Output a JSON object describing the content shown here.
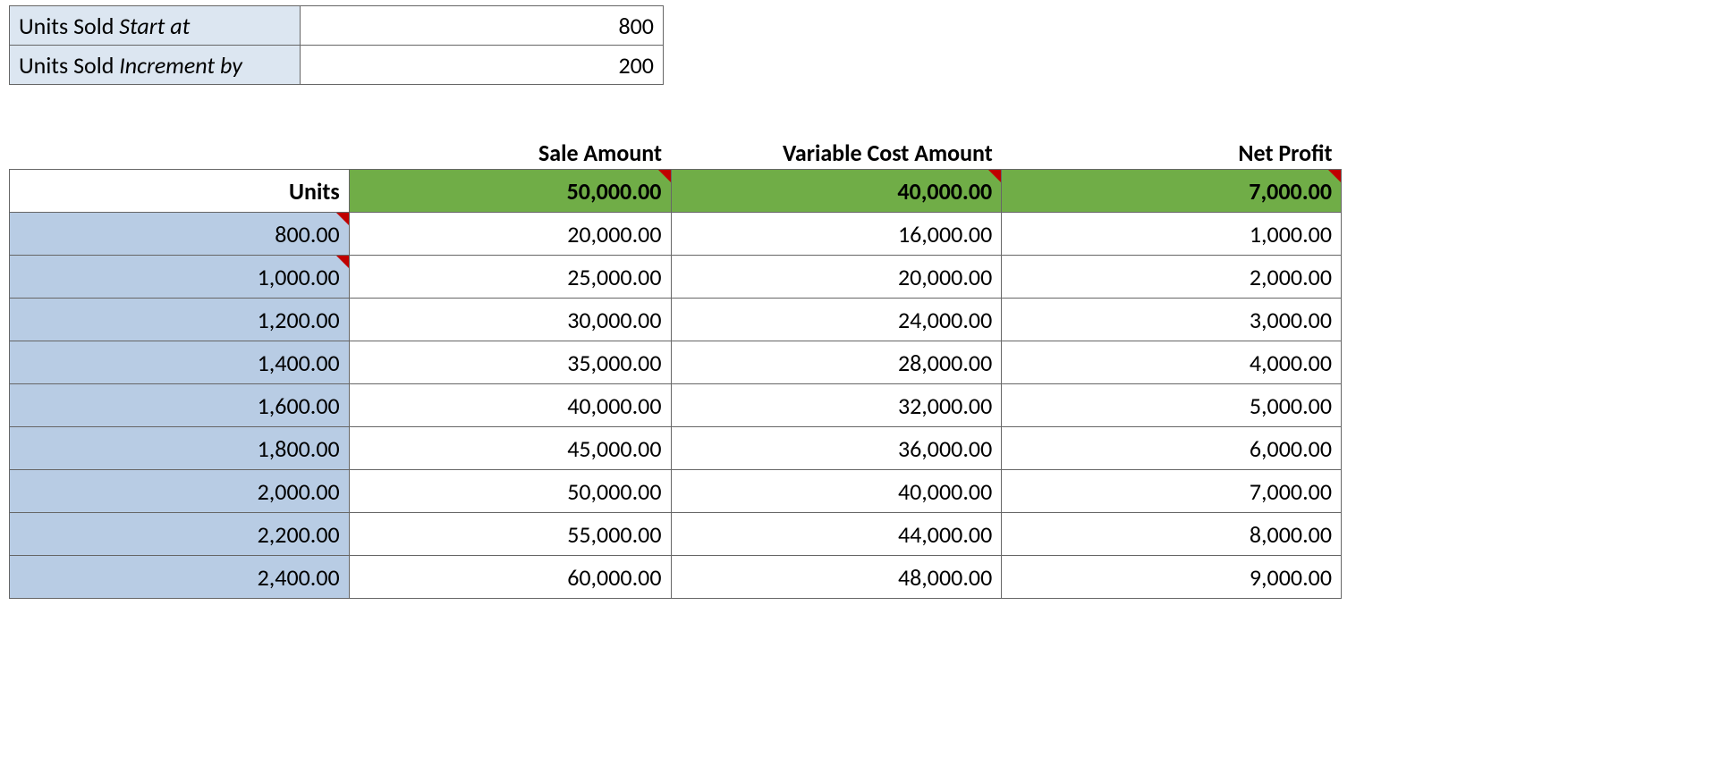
{
  "params": {
    "start_label_prefix": "Units Sold ",
    "start_label_ital": "Start at",
    "start_value": "800",
    "incr_label_prefix": "Units Sold ",
    "incr_label_ital": "Increment by",
    "incr_value": "200"
  },
  "headers": {
    "sale": "Sale Amount",
    "vcost": "Variable Cost Amount",
    "profit": "Net Profit",
    "units": "Units"
  },
  "totals": {
    "sale": "50,000.00",
    "vcost": "40,000.00",
    "profit": "7,000.00"
  },
  "rows": [
    {
      "units": "800.00",
      "sale": "20,000.00",
      "vcost": "16,000.00",
      "profit": "1,000.00",
      "cmt": true
    },
    {
      "units": "1,000.00",
      "sale": "25,000.00",
      "vcost": "20,000.00",
      "profit": "2,000.00",
      "cmt": true
    },
    {
      "units": "1,200.00",
      "sale": "30,000.00",
      "vcost": "24,000.00",
      "profit": "3,000.00",
      "cmt": false
    },
    {
      "units": "1,400.00",
      "sale": "35,000.00",
      "vcost": "28,000.00",
      "profit": "4,000.00",
      "cmt": false
    },
    {
      "units": "1,600.00",
      "sale": "40,000.00",
      "vcost": "32,000.00",
      "profit": "5,000.00",
      "cmt": false
    },
    {
      "units": "1,800.00",
      "sale": "45,000.00",
      "vcost": "36,000.00",
      "profit": "6,000.00",
      "cmt": false
    },
    {
      "units": "2,000.00",
      "sale": "50,000.00",
      "vcost": "40,000.00",
      "profit": "7,000.00",
      "cmt": false
    },
    {
      "units": "2,200.00",
      "sale": "55,000.00",
      "vcost": "44,000.00",
      "profit": "8,000.00",
      "cmt": false
    },
    {
      "units": "2,400.00",
      "sale": "60,000.00",
      "vcost": "48,000.00",
      "profit": "9,000.00",
      "cmt": false
    }
  ],
  "chart_data": {
    "type": "table",
    "title": "",
    "columns": [
      "Units",
      "Sale Amount",
      "Variable Cost Amount",
      "Net Profit"
    ],
    "header_values": {
      "sale": 50000,
      "vcost": 40000,
      "profit": 7000
    },
    "rows": [
      {
        "units": 800,
        "sale": 20000,
        "vcost": 16000,
        "profit": 1000
      },
      {
        "units": 1000,
        "sale": 25000,
        "vcost": 20000,
        "profit": 2000
      },
      {
        "units": 1200,
        "sale": 30000,
        "vcost": 24000,
        "profit": 3000
      },
      {
        "units": 1400,
        "sale": 35000,
        "vcost": 28000,
        "profit": 4000
      },
      {
        "units": 1600,
        "sale": 40000,
        "vcost": 32000,
        "profit": 5000
      },
      {
        "units": 1800,
        "sale": 45000,
        "vcost": 36000,
        "profit": 6000
      },
      {
        "units": 2000,
        "sale": 50000,
        "vcost": 40000,
        "profit": 7000
      },
      {
        "units": 2200,
        "sale": 55000,
        "vcost": 44000,
        "profit": 8000
      },
      {
        "units": 2400,
        "sale": 60000,
        "vcost": 48000,
        "profit": 9000
      }
    ],
    "params": {
      "units_start": 800,
      "units_increment": 200
    }
  }
}
